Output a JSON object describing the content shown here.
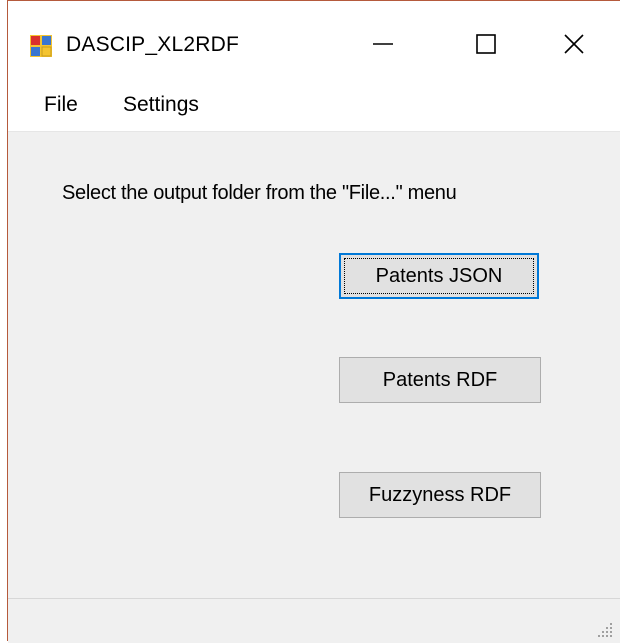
{
  "window": {
    "title": "DASCIP_XL2RDF",
    "accent_border_color": "#b55a3c",
    "focus_color": "#0078d7"
  },
  "titlebar": {
    "app_icon": "windows-forms-app-icon",
    "minimize_icon": "minimize-icon",
    "maximize_icon": "maximize-icon",
    "close_icon": "close-icon"
  },
  "menu": {
    "items": [
      {
        "label": "File"
      },
      {
        "label": "Settings"
      }
    ]
  },
  "main": {
    "instruction": "Select the output folder from the \"File...\" menu",
    "buttons": {
      "patents_json": "Patents JSON",
      "patents_rdf": "Patents RDF",
      "fuzzyness_rdf": "Fuzzyness RDF"
    }
  },
  "statusbar": {
    "grip_icon": "resize-grip-icon"
  }
}
